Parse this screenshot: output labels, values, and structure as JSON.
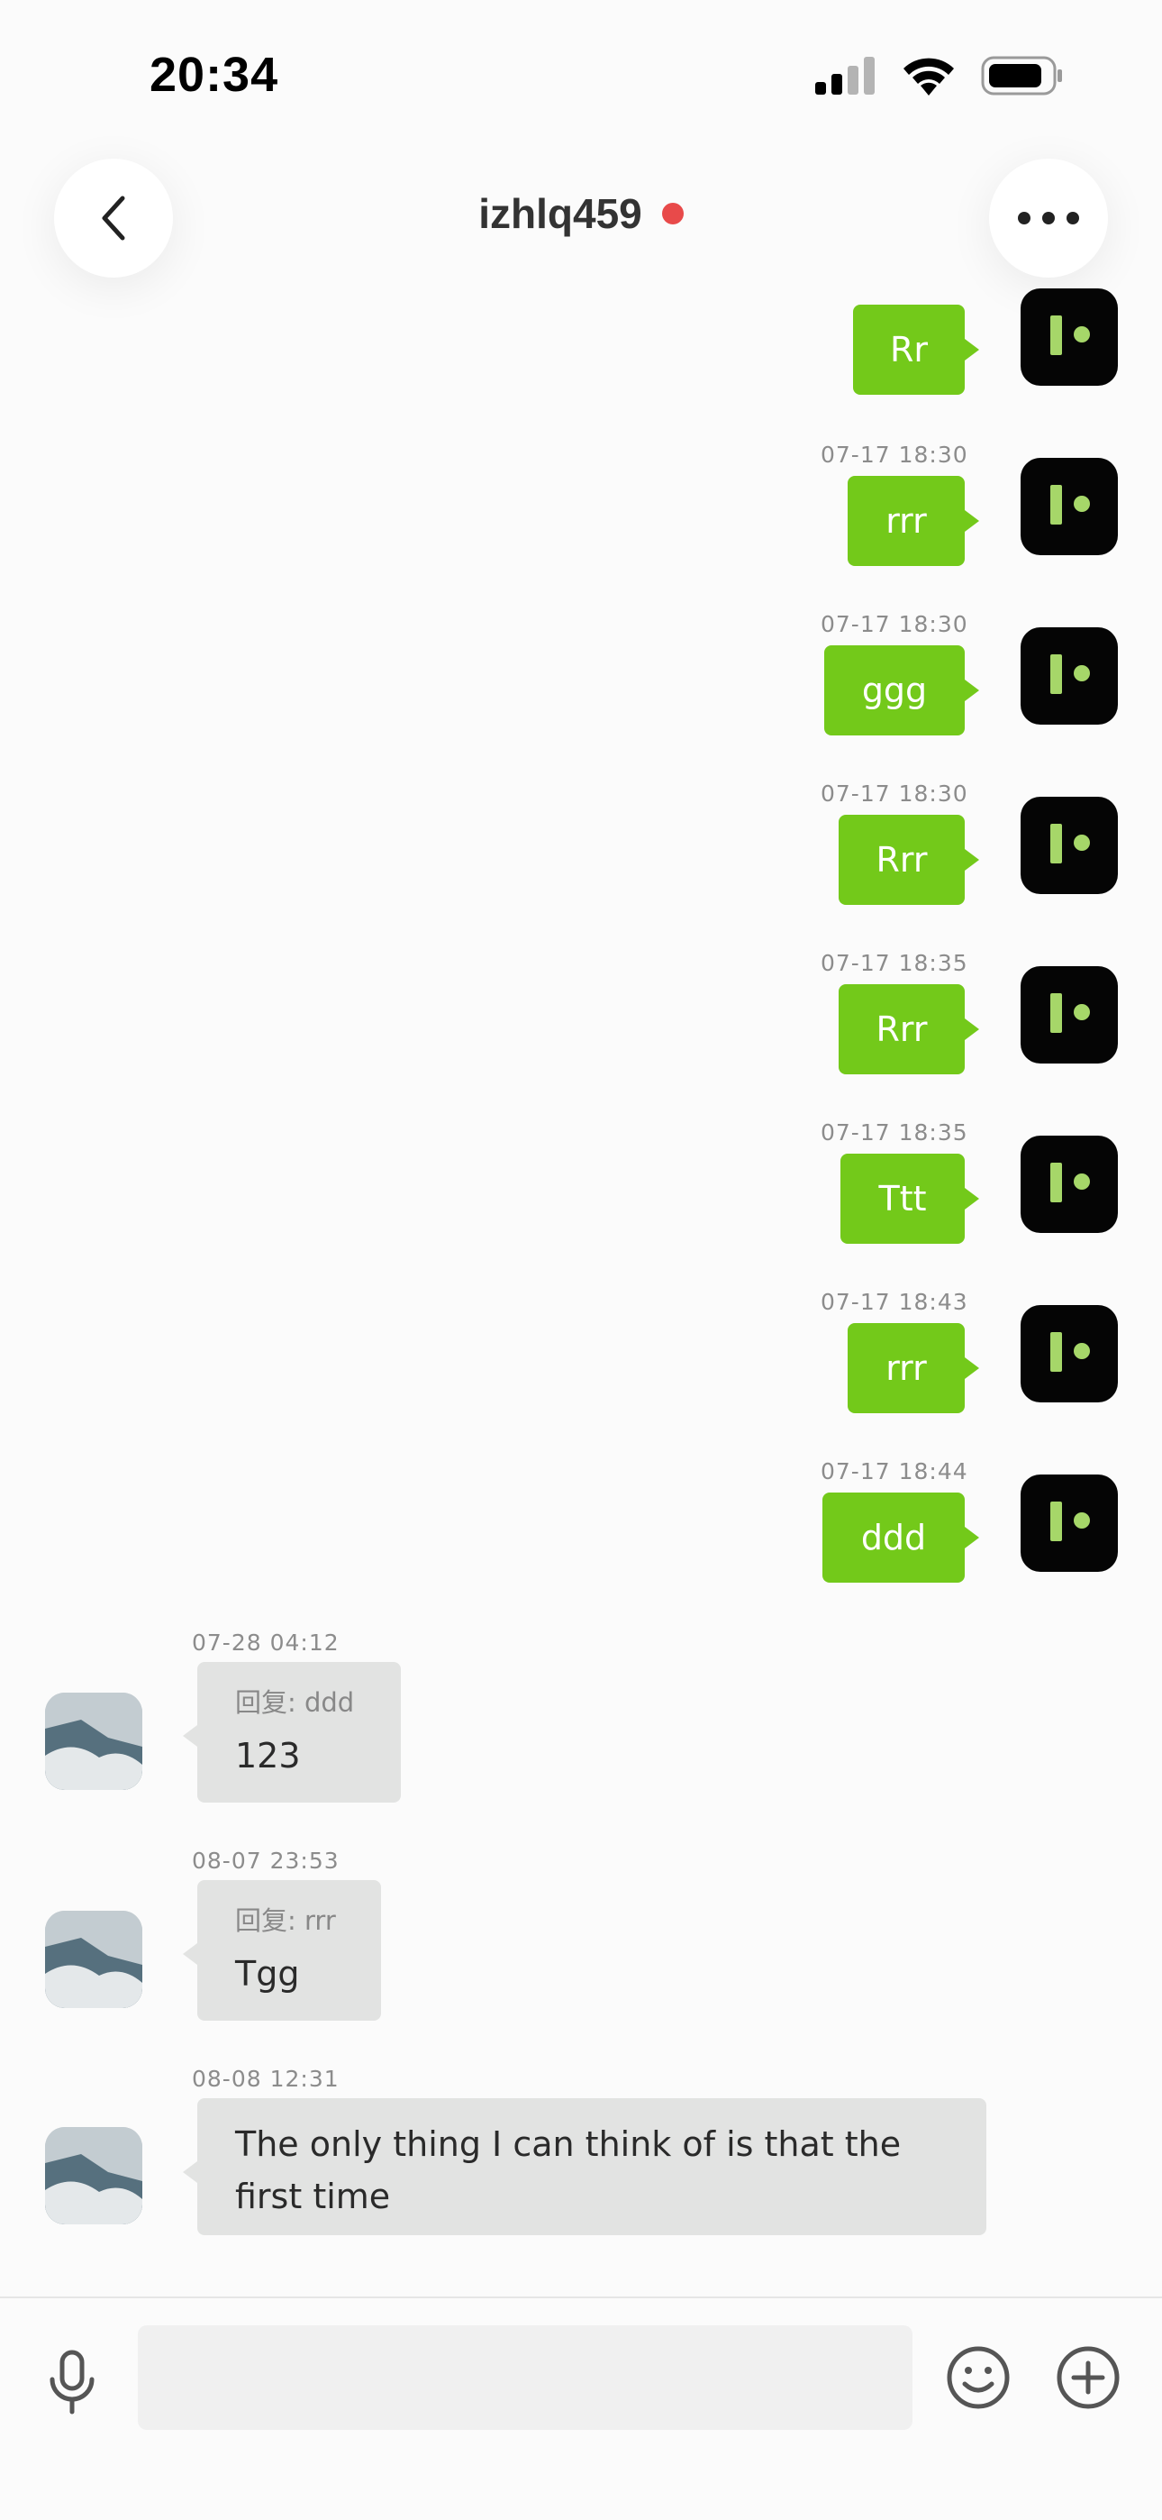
{
  "status_bar": {
    "time": "20:34",
    "icons": [
      "cellular-signal-icon",
      "wifi-icon",
      "battery-icon"
    ]
  },
  "header": {
    "contact_name": "izhlq459",
    "online_color": "#e84a4a",
    "back_icon": "chevron-left-icon",
    "more_icon": "more-horizontal-icon"
  },
  "outgoing_messages": [
    {
      "time": "",
      "text": "Rr"
    },
    {
      "time": "07-17 18:30",
      "text": "rrr"
    },
    {
      "time": "07-17 18:30",
      "text": "ggg"
    },
    {
      "time": "07-17 18:30",
      "text": "Rrr"
    },
    {
      "time": "07-17 18:35",
      "text": "Rrr"
    },
    {
      "time": "07-17 18:35",
      "text": "Ttt"
    },
    {
      "time": "07-17 18:43",
      "text": "rrr"
    },
    {
      "time": "07-17 18:44",
      "text": "ddd"
    }
  ],
  "incoming_messages": [
    {
      "time": "07-28 04:12",
      "reply_quote": "回复: ddd",
      "text": "123"
    },
    {
      "time": "08-07 23:53",
      "reply_quote": "回复: rrr",
      "text": "Tgg"
    },
    {
      "time": "08-08 12:31",
      "reply_quote": "",
      "text": "The only thing I can think of is that the first time"
    }
  ],
  "input_bar": {
    "placeholder": "",
    "value": "",
    "icons": [
      "microphone-icon",
      "emoji-icon",
      "plus-circle-icon"
    ]
  },
  "colors": {
    "outgoing_bubble": "#73c91a",
    "incoming_bubble": "#e2e3e2",
    "self_avatar_bg": "#050505",
    "self_avatar_mark": "#a6d769",
    "background": "#fbfbfb"
  }
}
